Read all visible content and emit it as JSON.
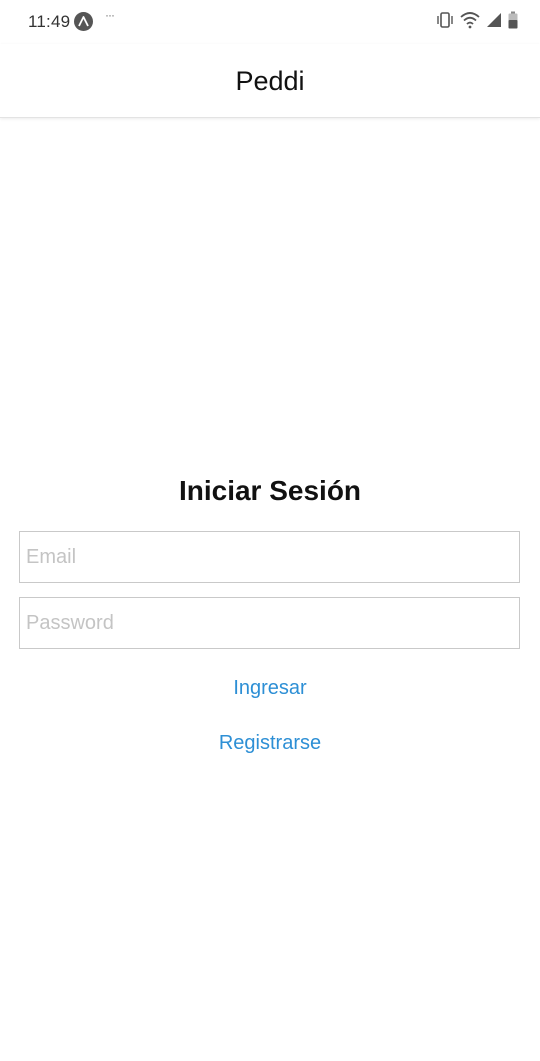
{
  "status_bar": {
    "time": "11:49",
    "app_icon": "expo-icon",
    "overflow": "···",
    "icons": [
      "vibrate-icon",
      "wifi-icon",
      "signal-icon",
      "battery-icon"
    ]
  },
  "header": {
    "title": "Peddi"
  },
  "login": {
    "heading": "Iniciar Sesión",
    "email_placeholder": "Email",
    "email_value": "",
    "password_placeholder": "Password",
    "password_value": "",
    "submit_label": "Ingresar",
    "register_label": "Registrarse"
  },
  "colors": {
    "accent": "#2d8fd5",
    "field_border": "#c9c9c9",
    "placeholder": "#c4c4c4"
  }
}
